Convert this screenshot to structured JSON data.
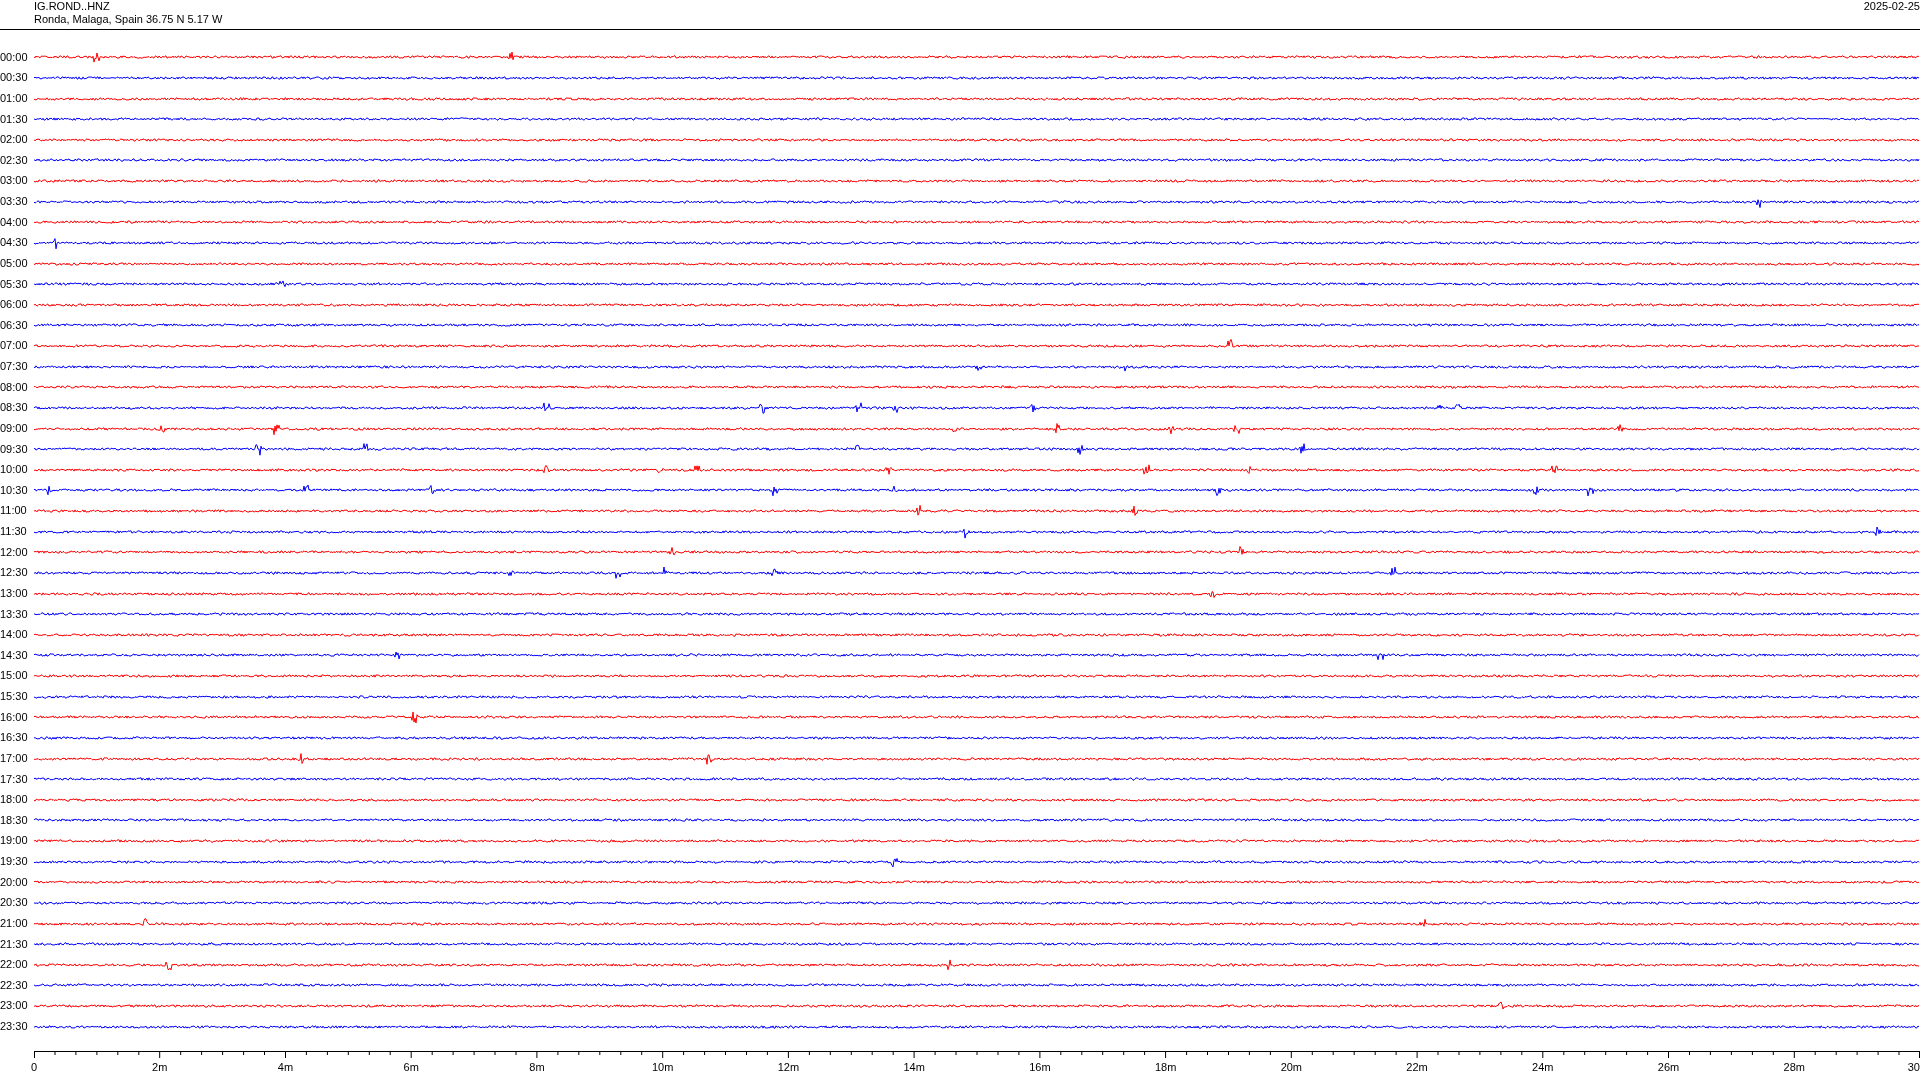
{
  "header": {
    "station": "IG.ROND..HNZ",
    "location": "Ronda, Malaga, Spain  36.75 N 5.17 W",
    "date": "2025-02-25"
  },
  "rows": [
    {
      "time": "00:00",
      "color": "#ff0000"
    },
    {
      "time": "00:30",
      "color": "#0000ff"
    },
    {
      "time": "01:00",
      "color": "#ff0000"
    },
    {
      "time": "01:30",
      "color": "#0000ff"
    },
    {
      "time": "02:00",
      "color": "#ff0000"
    },
    {
      "time": "02:30",
      "color": "#0000ff"
    },
    {
      "time": "03:00",
      "color": "#ff0000"
    },
    {
      "time": "03:30",
      "color": "#0000ff"
    },
    {
      "time": "04:00",
      "color": "#ff0000"
    },
    {
      "time": "04:30",
      "color": "#0000ff"
    },
    {
      "time": "05:00",
      "color": "#ff0000"
    },
    {
      "time": "05:30",
      "color": "#0000ff"
    },
    {
      "time": "06:00",
      "color": "#ff0000"
    },
    {
      "time": "06:30",
      "color": "#0000ff"
    },
    {
      "time": "07:00",
      "color": "#ff0000"
    },
    {
      "time": "07:30",
      "color": "#0000ff"
    },
    {
      "time": "08:00",
      "color": "#ff0000"
    },
    {
      "time": "08:30",
      "color": "#0000ff"
    },
    {
      "time": "09:00",
      "color": "#ff0000"
    },
    {
      "time": "09:30",
      "color": "#0000ff"
    },
    {
      "time": "10:00",
      "color": "#ff0000"
    },
    {
      "time": "10:30",
      "color": "#0000ff"
    },
    {
      "time": "11:00",
      "color": "#ff0000"
    },
    {
      "time": "11:30",
      "color": "#0000ff"
    },
    {
      "time": "12:00",
      "color": "#ff0000"
    },
    {
      "time": "12:30",
      "color": "#0000ff"
    },
    {
      "time": "13:00",
      "color": "#ff0000"
    },
    {
      "time": "13:30",
      "color": "#0000ff"
    },
    {
      "time": "14:00",
      "color": "#ff0000"
    },
    {
      "time": "14:30",
      "color": "#0000ff"
    },
    {
      "time": "15:00",
      "color": "#ff0000"
    },
    {
      "time": "15:30",
      "color": "#0000ff"
    },
    {
      "time": "16:00",
      "color": "#ff0000"
    },
    {
      "time": "16:30",
      "color": "#0000ff"
    },
    {
      "time": "17:00",
      "color": "#ff0000"
    },
    {
      "time": "17:30",
      "color": "#0000ff"
    },
    {
      "time": "18:00",
      "color": "#ff0000"
    },
    {
      "time": "18:30",
      "color": "#0000ff"
    },
    {
      "time": "19:00",
      "color": "#ff0000"
    },
    {
      "time": "19:30",
      "color": "#0000ff"
    },
    {
      "time": "20:00",
      "color": "#ff0000"
    },
    {
      "time": "20:30",
      "color": "#0000ff"
    },
    {
      "time": "21:00",
      "color": "#ff0000"
    },
    {
      "time": "21:30",
      "color": "#0000ff"
    },
    {
      "time": "22:00",
      "color": "#ff0000"
    },
    {
      "time": "22:30",
      "color": "#0000ff"
    },
    {
      "time": "23:00",
      "color": "#ff0000"
    },
    {
      "time": "23:30",
      "color": "#0000ff"
    }
  ],
  "axis": {
    "labels": [
      "0",
      "2m",
      "4m",
      "6m",
      "8m",
      "10m",
      "12m",
      "14m",
      "16m",
      "18m",
      "20m",
      "22m",
      "24m",
      "26m",
      "28m",
      "30"
    ]
  }
}
